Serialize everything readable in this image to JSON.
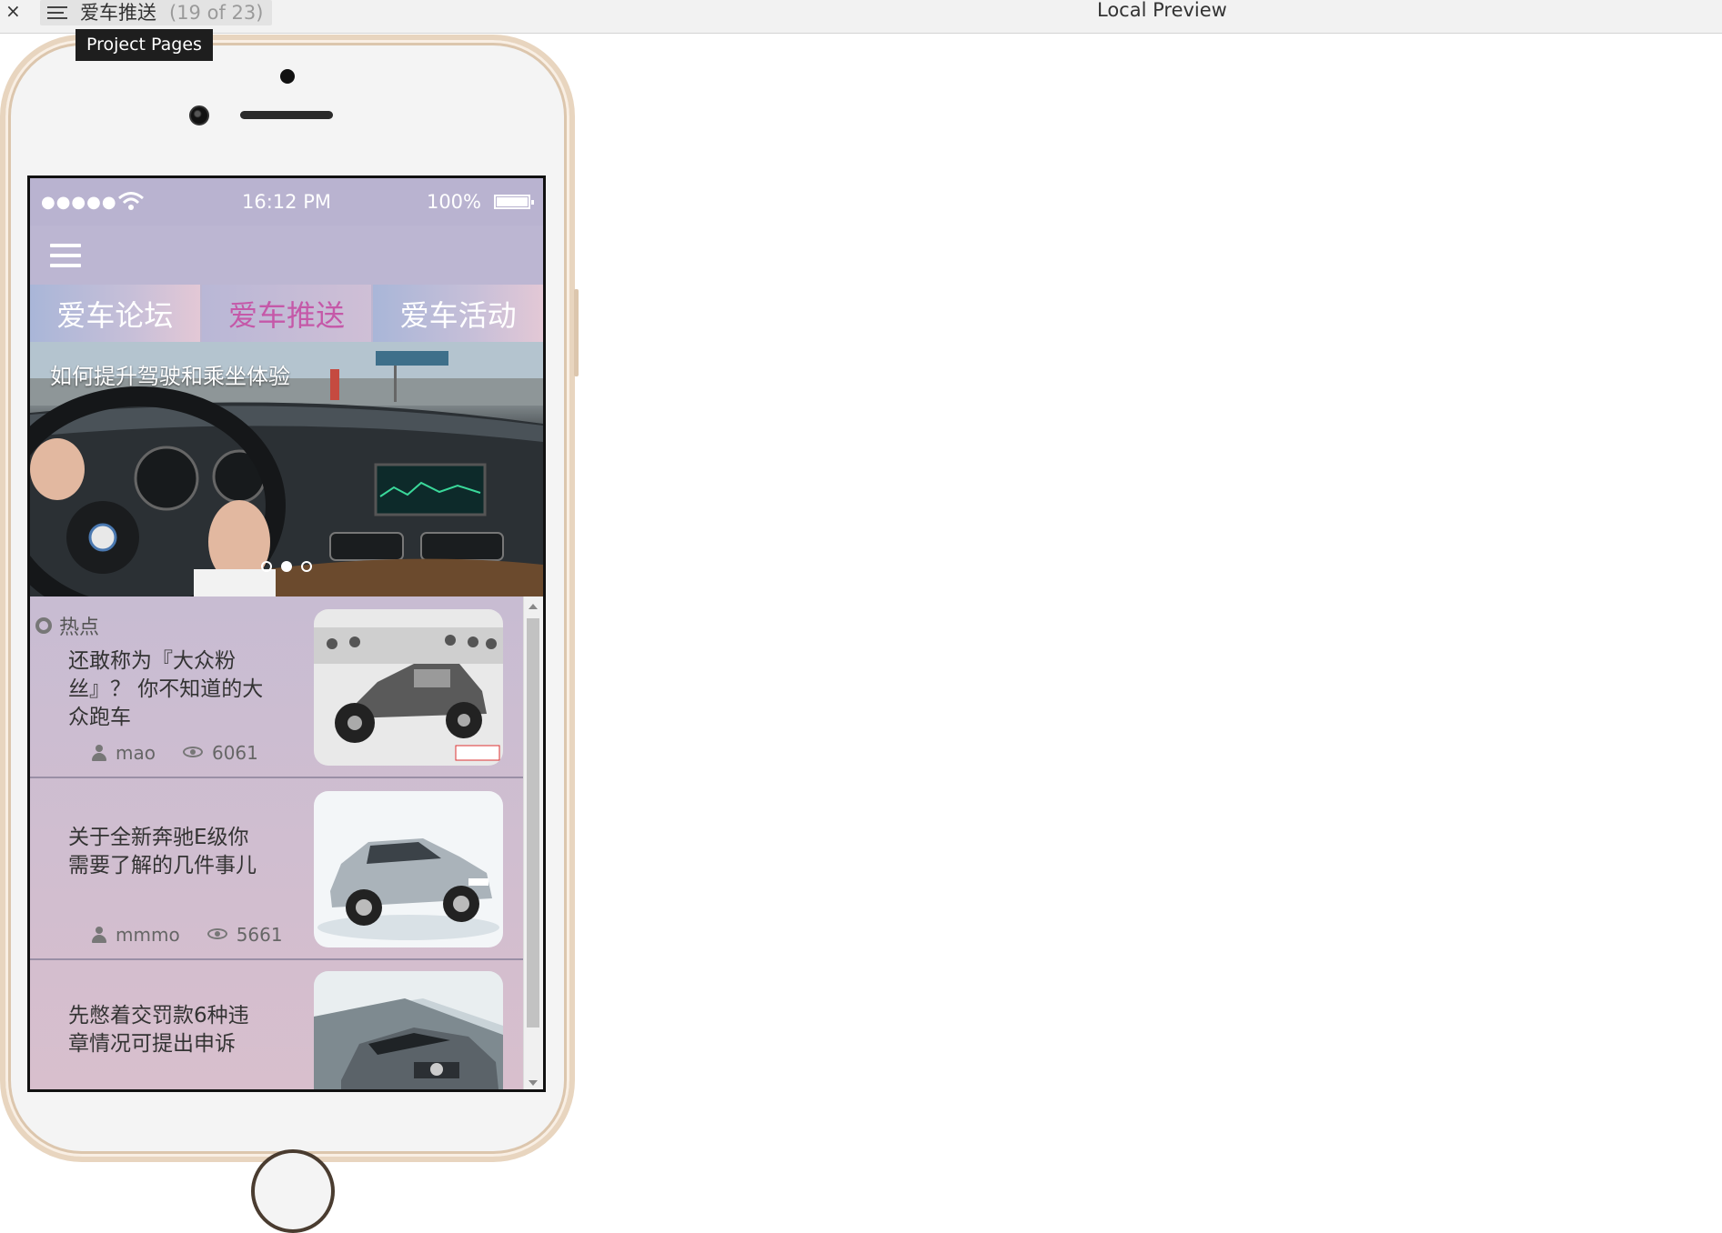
{
  "toolbar": {
    "close_glyph": "×",
    "page_name": "爱车推送",
    "page_count": "(19 of 23)",
    "tooltip": "Project Pages",
    "preview_title": "Local Preview"
  },
  "statusbar": {
    "signal": "●●●●●",
    "time": "16:12 PM",
    "battery": "100%"
  },
  "tabs": [
    {
      "label": "爱车论坛"
    },
    {
      "label": "爱车推送"
    },
    {
      "label": "爱车活动"
    }
  ],
  "banner": {
    "caption": "如何提升驾驶和乘坐体验",
    "slide_count": 3,
    "active_slide": 2
  },
  "hot_label": "热点",
  "articles": [
    {
      "title": "还敢称为『大众粉丝』？ 你不知道的大众跑车",
      "author": "mao",
      "views": "6061"
    },
    {
      "title": "关于全新奔驰E级你需要了解的几件事儿",
      "author": "mmmo",
      "views": "5661"
    },
    {
      "title": "先憋着交罚款6种违章情况可提出申诉",
      "author": "",
      "views": ""
    }
  ],
  "colors": {
    "accent_tab": "#c558a8",
    "phone_gold": "#e8d5bf"
  }
}
